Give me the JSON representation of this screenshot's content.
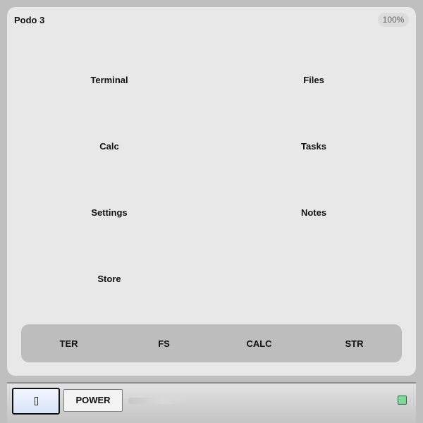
{
  "status": {
    "title": "Podo 3",
    "battery": "100%"
  },
  "apps": [
    {
      "label": "Terminal"
    },
    {
      "label": "Files"
    },
    {
      "label": "Calc"
    },
    {
      "label": "Tasks"
    },
    {
      "label": "Settings"
    },
    {
      "label": "Notes"
    },
    {
      "label": "Store"
    }
  ],
  "dock": [
    {
      "label": "TER"
    },
    {
      "label": "FS"
    },
    {
      "label": "CALC"
    },
    {
      "label": "STR"
    }
  ],
  "hardware": {
    "menu_icon": "menu-icon",
    "power_label": "POWER",
    "led_color": "#7fd89a"
  }
}
